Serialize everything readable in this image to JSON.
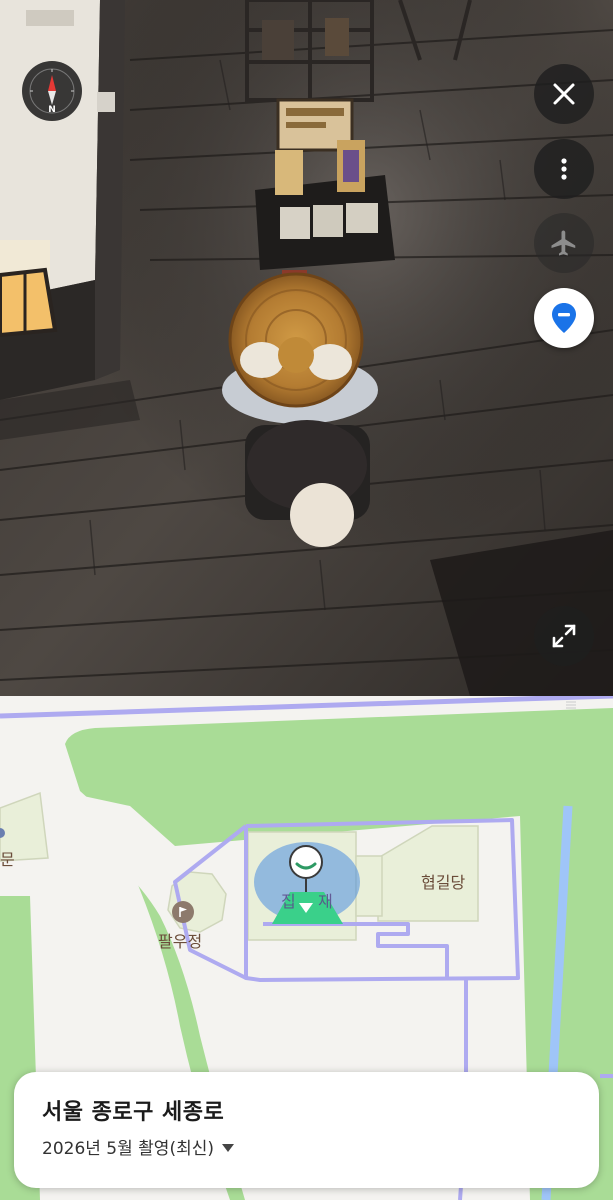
{
  "compass": {
    "north_label": "N"
  },
  "controls": {
    "close_icon": "close-icon",
    "more_icon": "more-vertical-icon",
    "airplane_icon": "airplane-icon",
    "pin_icon": "location-pin-icon",
    "expand_icon": "expand-icon"
  },
  "map": {
    "labels": {
      "hyeopgildang": "협길당",
      "palujeong": "팔우정",
      "gate_partial": "문",
      "current_partial": "집",
      "current_suffix": "재"
    },
    "colors": {
      "park": "#a9dc96",
      "path": "#aeaaf0",
      "water": "#9fc5f8",
      "view_cone": "#4d8ee0",
      "marker": "#3ad08a"
    }
  },
  "info_card": {
    "title": "서울 종로구 세종로",
    "date": "2026년 5월 촬영(최신)"
  }
}
